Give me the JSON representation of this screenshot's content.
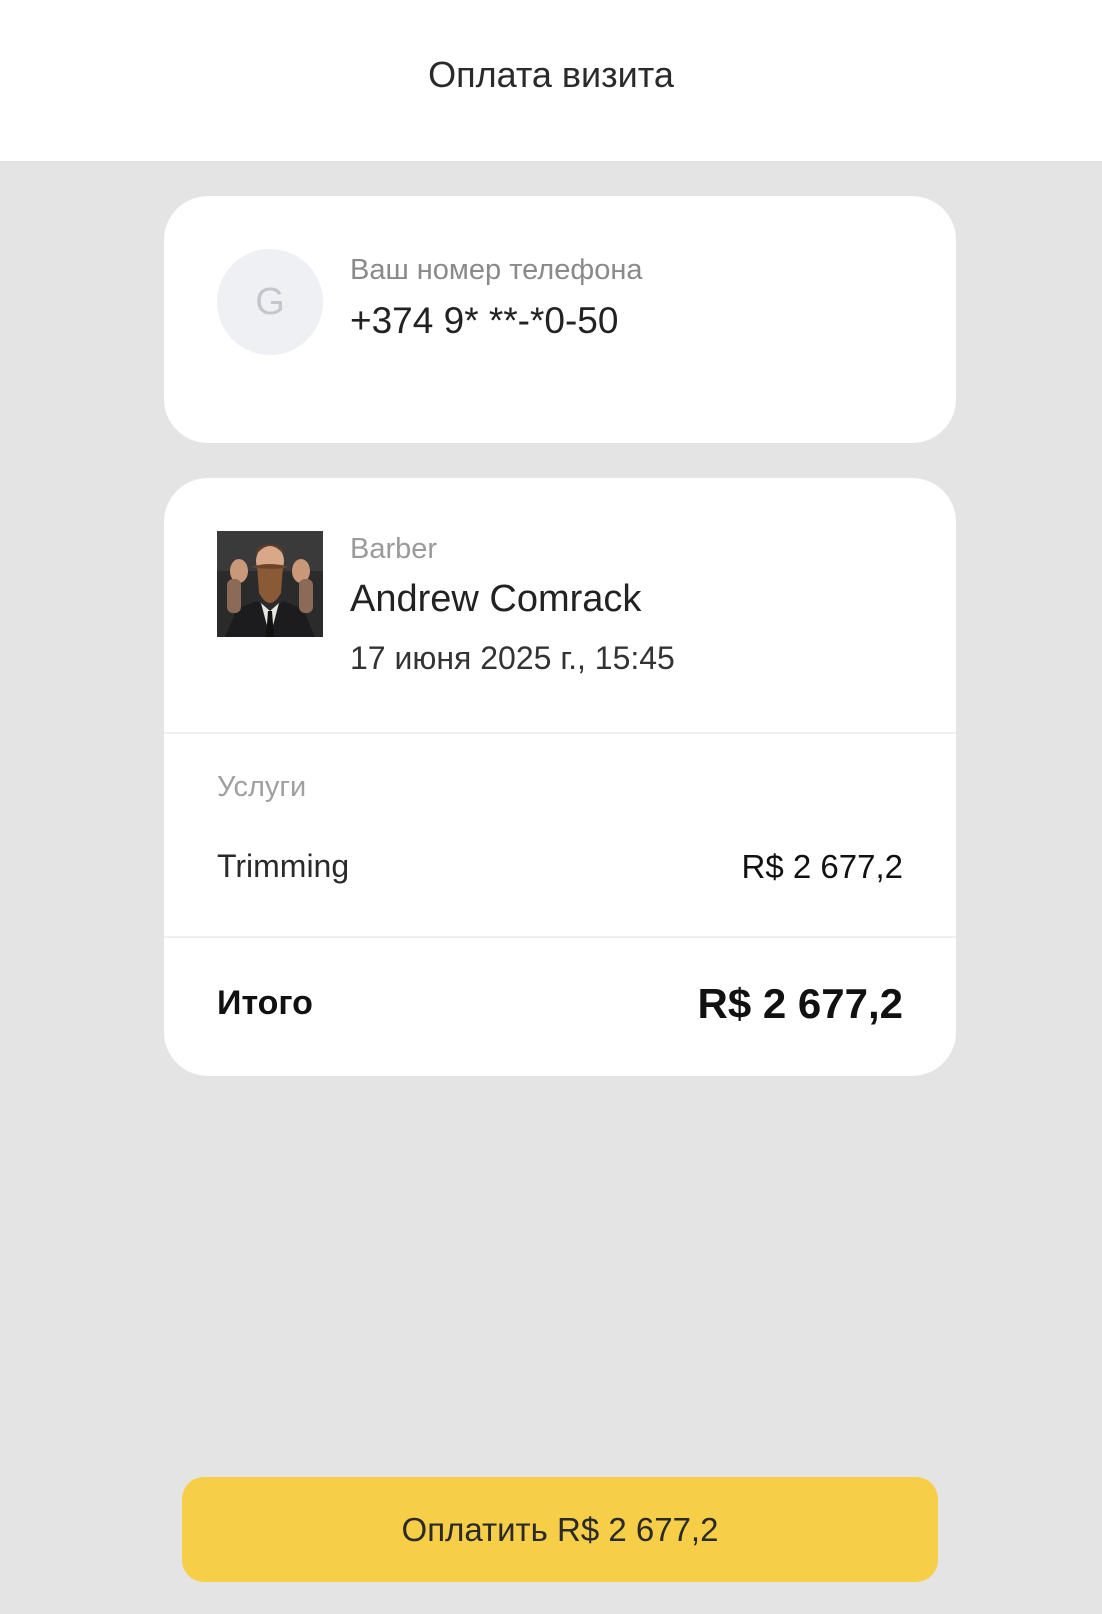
{
  "header": {
    "title": "Оплата визита"
  },
  "phone_card": {
    "avatar_letter": "G",
    "label": "Ваш номер телефона",
    "value": "+374 9* **-*0-50"
  },
  "visit_card": {
    "role": "Barber",
    "name": "Andrew Comrack",
    "datetime": "17 июня 2025 г., 15:45",
    "services_label": "Услуги",
    "services": [
      {
        "name": "Trimming",
        "price": "R$ 2 677,2"
      }
    ],
    "total_label": "Итого",
    "total_value": "R$ 2 677,2"
  },
  "pay_button": {
    "label": "Оплатить R$ 2 677,2"
  },
  "colors": {
    "background": "#e4e4e4",
    "card": "#ffffff",
    "accent": "#f6ce48"
  }
}
